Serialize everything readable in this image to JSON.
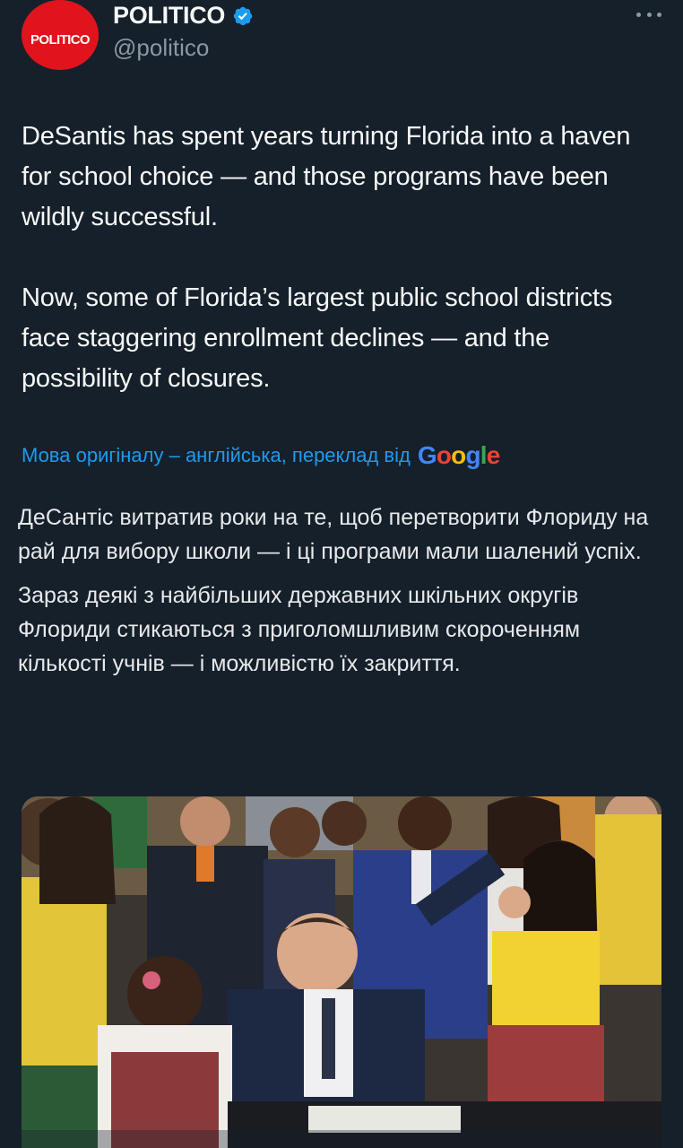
{
  "account": {
    "display_name": "POLITICO",
    "handle": "@politico",
    "avatar_text": "POLITICO",
    "avatar_color": "#e1141d",
    "verified": true
  },
  "tweet": {
    "paragraph_1": "DeSantis has spent years turning Florida into a haven for school choice — and those programs have been wildly successful.",
    "paragraph_2": "Now, some of Florida’s largest public school districts face staggering enrollment declines — and the possibility of closures."
  },
  "translation": {
    "label": "Мова оригіналу – англійська, переклад від",
    "provider_letters": [
      "G",
      "o",
      "o",
      "g",
      "l",
      "e"
    ],
    "paragraph_1": "ДеСантіс витратив роки на те, щоб перетворити Флориду на рай для вибору школи — і ці програми мали шалений успіх.",
    "paragraph_2": "Зараз деякі з найбільших державних шкільних округів Флориди стикаються з приголомшливим скороченням кількості учнів — і можливістю їх закриття."
  },
  "colors": {
    "background": "#15202b",
    "text": "#f7f9f9",
    "secondary": "#8b98a5",
    "link": "#1d9bf0"
  },
  "icons": [
    "verified-badge-icon",
    "more-options-icon"
  ]
}
